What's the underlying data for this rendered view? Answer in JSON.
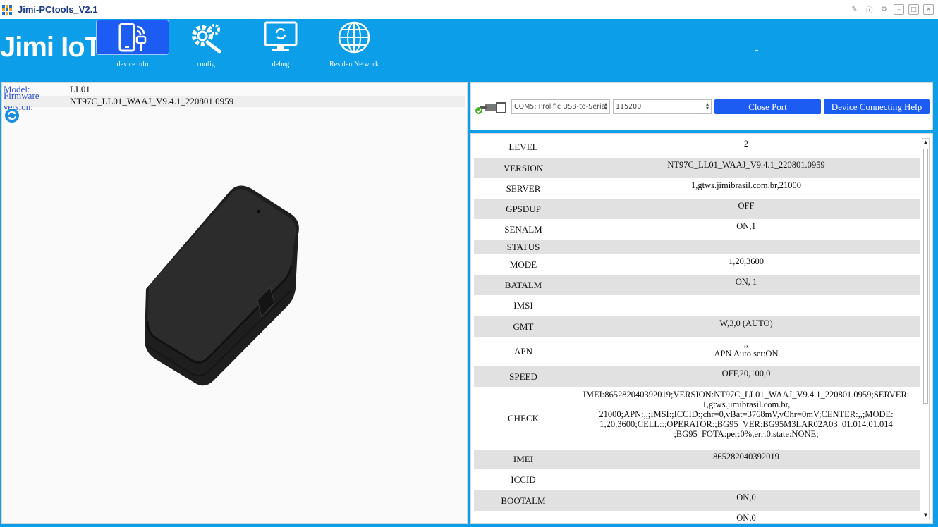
{
  "window": {
    "title": "Jimi-PCtools_V2.1"
  },
  "brand": {
    "logo": "Jimi IoT"
  },
  "nav": [
    {
      "label": "device info",
      "icon": "phone-signal-icon"
    },
    {
      "label": "config",
      "icon": "gears-icon"
    },
    {
      "label": "debug",
      "icon": "monitor-icon"
    },
    {
      "label": "ResidentNetwork",
      "icon": "globe-icon"
    }
  ],
  "device": {
    "model_label": "Model:",
    "model": "LL01",
    "firmware_label": "Firmware version:",
    "firmware": "NT97C_LL01_WAAJ_V9.4.1_220801.0959"
  },
  "connection": {
    "port": "COM5: Prolific USB-to-Seria",
    "baud": "115200",
    "close_label": "Close Port",
    "help_label": "Device Connecting Help"
  },
  "params": [
    {
      "name": "LEVEL",
      "value": "2"
    },
    {
      "name": "VERSION",
      "value": "NT97C_LL01_WAAJ_V9.4.1_220801.0959"
    },
    {
      "name": "SERVER",
      "value": "1,gtws.jimibrasil.com.br,21000"
    },
    {
      "name": "GPSDUP",
      "value": "OFF"
    },
    {
      "name": "SENALM",
      "value": "ON,1"
    },
    {
      "name": "STATUS",
      "value": ""
    },
    {
      "name": "MODE",
      "value": "1,20,3600"
    },
    {
      "name": "BATALM",
      "value": "ON, 1"
    },
    {
      "name": "IMSI",
      "value": ""
    },
    {
      "name": "GMT",
      "value": "W,3,0 (AUTO)"
    },
    {
      "name": "APN",
      "value": ",,\nAPN Auto set:ON"
    },
    {
      "name": "SPEED",
      "value": "OFF,20,100,0"
    },
    {
      "name": "CHECK",
      "value": "IMEI:865282040392019;VERSION:NT97C_LL01_WAAJ_V9.4.1_220801.0959;SERVER:\n1,gtws.jimibrasil.com.br,\n21000;APN:,,;IMSI:;ICCID:;chr=0,vBat=3768mV,vChr=0mV;CENTER:,,;MODE:\n1,20,3600;CELL::;OPERATOR:;BG95_VER:BG95M3LAR02A03_01.014.01.014\n;BG95_FOTA:per:0%,err:0,state:NONE;"
    },
    {
      "name": "IMEI",
      "value": "865282040392019"
    },
    {
      "name": "ICCID",
      "value": ""
    },
    {
      "name": "BOOTALM",
      "value": "ON,0"
    },
    {
      "name": "",
      "value": "ON,0"
    }
  ]
}
